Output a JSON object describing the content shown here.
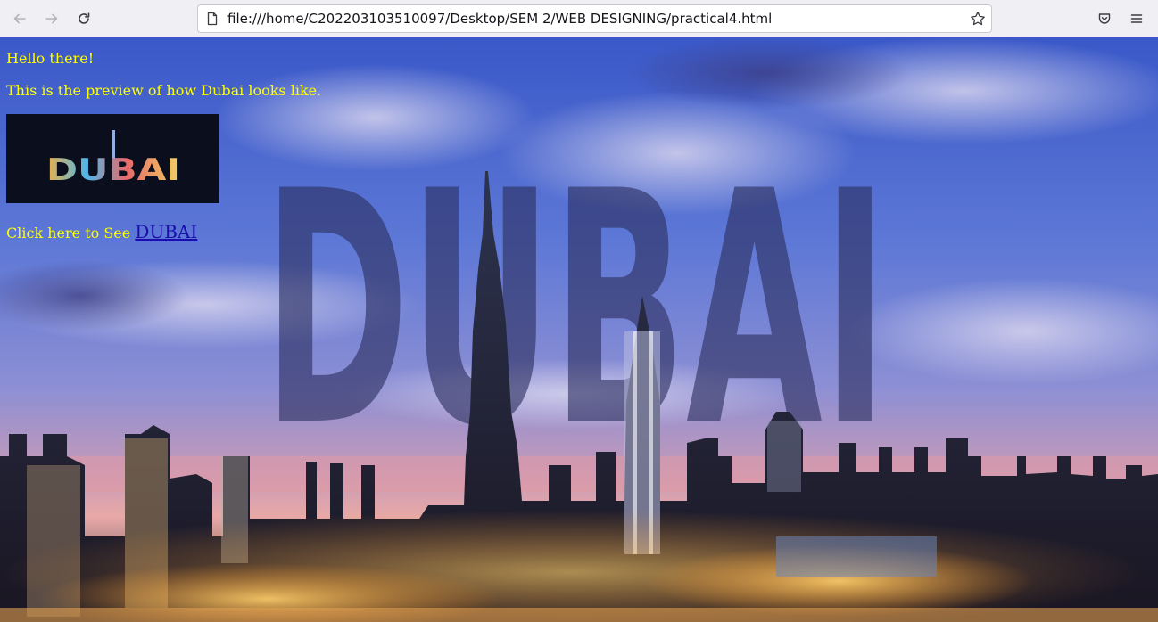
{
  "browser": {
    "url": "file:///home/C202203103510097/Desktop/SEM 2/WEB DESIGNING/practical4.html",
    "back_icon": "arrow-left-icon",
    "forward_icon": "arrow-right-icon",
    "reload_icon": "reload-icon",
    "bookmark_icon": "star-icon",
    "pocket_icon": "pocket-icon",
    "menu_icon": "hamburger-menu-icon"
  },
  "page": {
    "greeting": "Hello there!",
    "preview_text": "This is the preview of how Dubai looks like.",
    "thumb_text": "DUBAI",
    "link_prefix": "Click here to See ",
    "link_label": "DUBAI",
    "background_overlay_text": "DUBAI",
    "text_color": "#ffff00",
    "link_color": "#1a0dab"
  }
}
